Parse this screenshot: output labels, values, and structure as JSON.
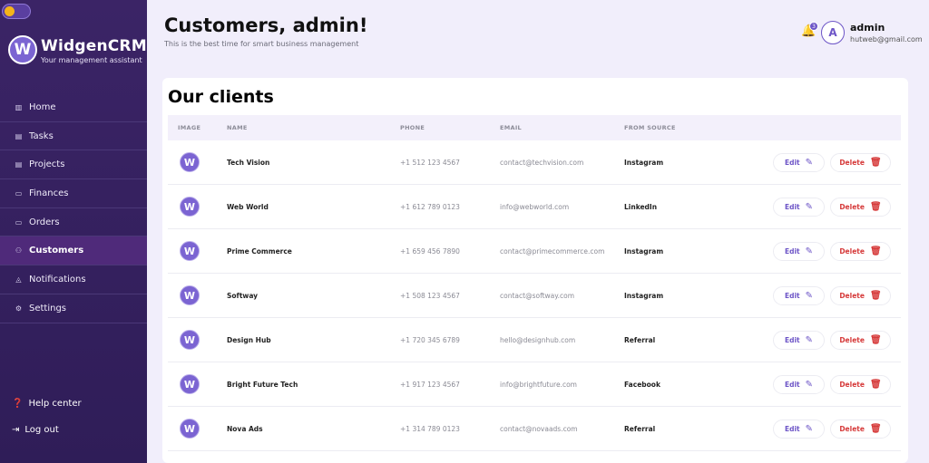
{
  "sidebar": {
    "brand": "WidgenCRM",
    "brand_sub": "Your management assistant",
    "logo_letter": "W",
    "items": [
      {
        "label": "Home",
        "icon": "home-icon",
        "glyph": "▥"
      },
      {
        "label": "Tasks",
        "icon": "tasks-icon",
        "glyph": "▤"
      },
      {
        "label": "Projects",
        "icon": "projects-icon",
        "glyph": "▤"
      },
      {
        "label": "Finances",
        "icon": "finances-icon",
        "glyph": "▭"
      },
      {
        "label": "Orders",
        "icon": "orders-icon",
        "glyph": "▭"
      },
      {
        "label": "Customers",
        "icon": "user-icon",
        "glyph": "⚇",
        "active": true
      },
      {
        "label": "Notifications",
        "icon": "bell-icon",
        "glyph": "◬"
      },
      {
        "label": "Settings",
        "icon": "gear-icon",
        "glyph": "⚙"
      }
    ],
    "help": "Help center",
    "logout": "Log out"
  },
  "header": {
    "title": "Customers, admin!",
    "subtitle": "This is the best time for smart business management",
    "notification_count": "3",
    "avatar_letter": "A",
    "user_name": "admin",
    "user_email": "hutweb@gmail.com"
  },
  "clients": {
    "title": "Our clients",
    "columns": {
      "image": "IMAGE",
      "name": "NAME",
      "phone": "PHONE",
      "email": "EMAIL",
      "source": "FROM SOURCE"
    },
    "edit_label": "Edit",
    "delete_label": "Delete",
    "rows": [
      {
        "name": "Tech Vision",
        "phone": "+1 512 123 4567",
        "email": "contact@techvision.com",
        "source": "Instagram"
      },
      {
        "name": "Web World",
        "phone": "+1 612 789 0123",
        "email": "info@webworld.com",
        "source": "LinkedIn"
      },
      {
        "name": "Prime Commerce",
        "phone": "+1 659 456 7890",
        "email": "contact@primecommerce.com",
        "source": "Instagram"
      },
      {
        "name": "Softway",
        "phone": "+1 508 123 4567",
        "email": "contact@softway.com",
        "source": "Instagram"
      },
      {
        "name": "Design Hub",
        "phone": "+1 720 345 6789",
        "email": "hello@designhub.com",
        "source": "Referral"
      },
      {
        "name": "Bright Future Tech",
        "phone": "+1 917 123 4567",
        "email": "info@brightfuture.com",
        "source": "Facebook"
      },
      {
        "name": "Nova Ads",
        "phone": "+1 314 789 0123",
        "email": "contact@novaads.com",
        "source": "Referral"
      }
    ]
  },
  "colors": {
    "sidebar_bg": "#3b2466",
    "accent": "#6d55c7",
    "delete": "#d63a3a",
    "page_bg": "#f1eefb"
  }
}
